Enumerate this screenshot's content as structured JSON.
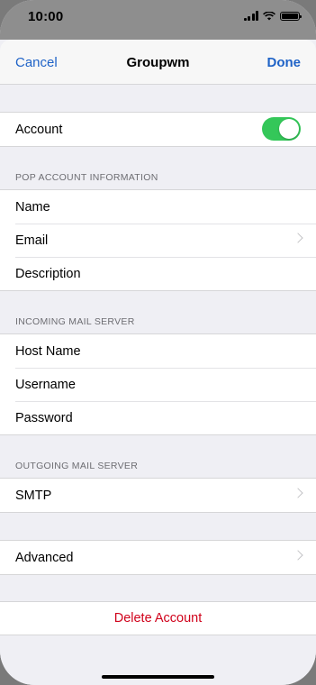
{
  "status": {
    "time": "10:00"
  },
  "nav": {
    "cancel": "Cancel",
    "title": "Groupwm",
    "done": "Done"
  },
  "account": {
    "label": "Account",
    "enabled": true
  },
  "pop_section": {
    "header": "POP ACCOUNT INFORMATION",
    "rows": [
      {
        "label": "Name"
      },
      {
        "label": "Email"
      },
      {
        "label": "Description"
      }
    ]
  },
  "incoming_section": {
    "header": "INCOMING MAIL SERVER",
    "rows": [
      {
        "label": "Host Name"
      },
      {
        "label": "Username"
      },
      {
        "label": "Password"
      }
    ]
  },
  "outgoing_section": {
    "header": "OUTGOING MAIL SERVER",
    "rows": [
      {
        "label": "SMTP"
      }
    ]
  },
  "advanced": {
    "label": "Advanced"
  },
  "delete": {
    "label": "Delete Account"
  },
  "colors": {
    "accent": "#1f63c7",
    "toggle_on": "#34c759",
    "destructive": "#d0021b"
  }
}
